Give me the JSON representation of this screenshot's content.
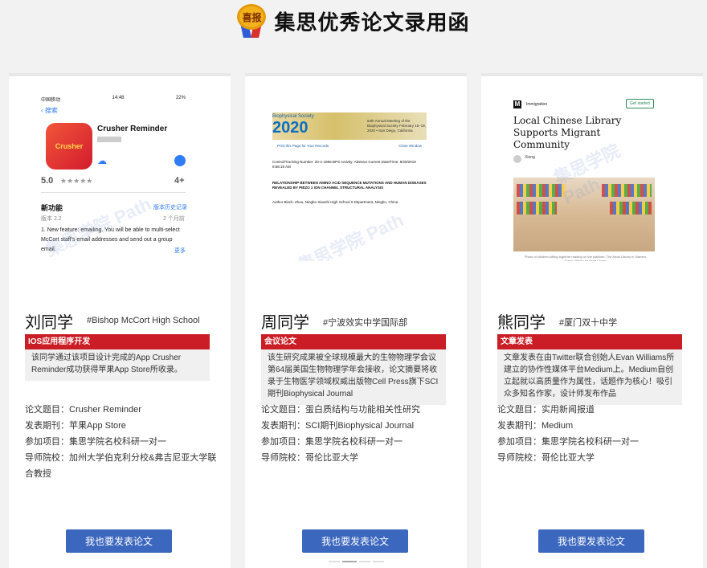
{
  "header": {
    "title": "集思优秀论文录用函",
    "badge_text": "喜报"
  },
  "cards": [
    {
      "name": "刘同学",
      "school": "#Bishop McCort High School",
      "category": "IOS应用程序开发",
      "summary": "该同学通过该项目设计完成的App Crusher Reminder成功获得苹果App Store所收录。",
      "info": [
        "论文题目：Crusher Reminder",
        "发表期刊：苹果App Store",
        "参加项目：集思学院名校科研一对一",
        "导师院校：加州大学伯克利分校&弗吉尼亚大学联合教授"
      ],
      "cta": "我也要发表论文",
      "thumb": {
        "carrier": "中国移动",
        "time": "14:48",
        "battery": "22%",
        "back": "搜索",
        "app_name": "Crusher Reminder",
        "icon_text": "Crusher",
        "rating": "5.0",
        "stars": "★★★★★",
        "age": "4+",
        "new_features": "新功能",
        "history": "版本历史记录",
        "version": "版本 2.2",
        "ago": "2 个月前",
        "description": "1. New feature: emailing. You will be able to multi-select McCort staff's email addresses and send out a group email.",
        "more": "更多"
      }
    },
    {
      "name": "周同学",
      "school": "#宁波效实中学国际部",
      "category": "会议论文",
      "summary": "该生研究成果被全球规模最大的生物物理学会议第64届美国生物物理学年会接收，论文摘要将收录于生物医学领域权威出版物Cell Press旗下SCI期刊Biophysical Journal",
      "info": [
        "论文题目：蛋白质结构与功能相关性研究",
        "发表期刊：SCI期刊Biophysical Journal",
        "参加项目：集思学院名校科研一对一",
        "导师院校：哥伦比亚大学"
      ],
      "cta": "我也要发表论文",
      "thumb": {
        "society": "Biophysical Society",
        "year": "2020",
        "meeting": "64th Annual Meeting of the Biophysical Society February 15–19, 2020 • San Diego, California",
        "link_left": "Print this Page for Your Records",
        "link_right": "Close Window",
        "meta": "Control/Tracking Number: 20-A-1865-BPS Activity: Abstract Current Date/Time: 9/29/2019 9:58:19 AM",
        "abstract_title": "RELATIONSHIP BETWEEN AMINO ACID SEQUENCE MUTATIONS AND HUMAN DISEASES REVEALED BY PIEZO 1 ION CHANNEL STRUCTURAL ANALYSIS",
        "author": "Author Block: Zhou, Ningbo Xiaoshi High School 0 Department, Ningbo, China"
      }
    },
    {
      "name": "熊同学",
      "school": "#厦门双十中学",
      "category": "文章发表",
      "summary": "文章发表在由Twitter联合创始人Evan Williams所建立的协作性媒体平台Medium上。Medium自创立起就以高质量作为属性，话题作为核心！吸引众多知名作家，设计师发布作品",
      "info": [
        "论文题目：实用新闻报道",
        "发表期刊：Medium",
        "参加项目：集思学院名校科研一对一",
        "导师院校：哥伦比亚大学"
      ],
      "cta": "我也要发表论文",
      "thumb": {
        "logo": "M",
        "tag": "Immigration",
        "get_started": "Get started",
        "title": "Local Chinese Library Supports Migrant Community",
        "author": "Xiong",
        "caption": "Photo of children sitting together reading on the platform, The Aeda Library in Xiamen, China | Photo by Aeda Library"
      }
    }
  ],
  "watermark": "集思学院 Path"
}
